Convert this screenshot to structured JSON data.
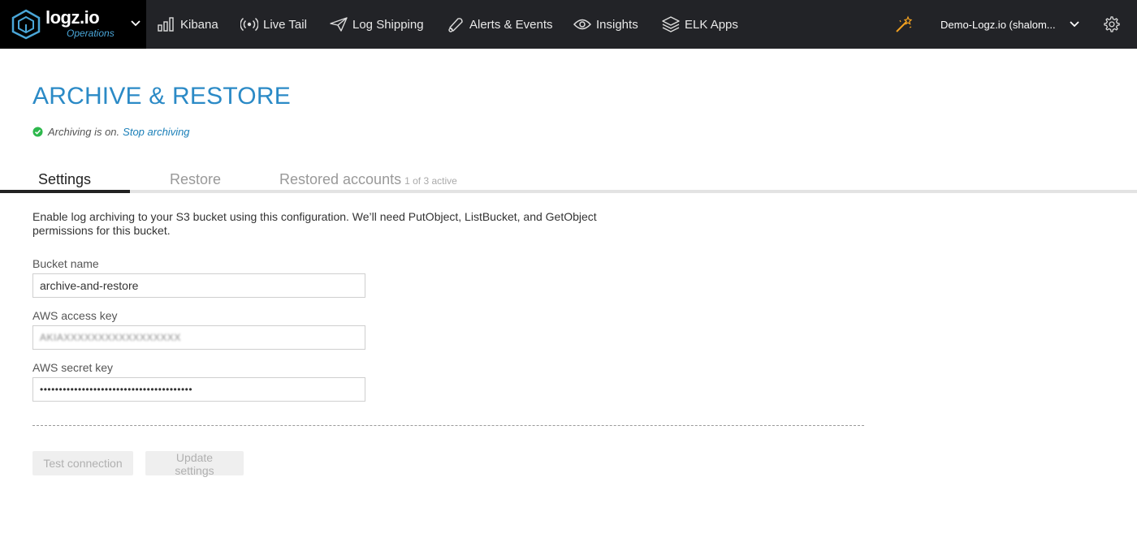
{
  "brand": {
    "name": "logz.io",
    "subtitle": "Operations",
    "accent": "#2b8ac6"
  },
  "nav": {
    "items": [
      {
        "label": "Kibana",
        "icon": "bar-chart-icon"
      },
      {
        "label": "Live Tail",
        "icon": "broadcast-icon"
      },
      {
        "label": "Log Shipping",
        "icon": "paper-plane-icon"
      },
      {
        "label": "Alerts & Events",
        "icon": "bell-icon"
      },
      {
        "label": "Insights",
        "icon": "eye-icon"
      },
      {
        "label": "ELK Apps",
        "icon": "layers-icon"
      }
    ],
    "account": "Demo-Logz.io (shalom..."
  },
  "page": {
    "title": "ARCHIVE & RESTORE",
    "status_text": "Archiving is on.",
    "status_link": "Stop archiving",
    "status_color": "#2db84c"
  },
  "tabs": {
    "settings": "Settings",
    "restore": "Restore",
    "restored_accounts": "Restored accounts",
    "restored_badge": "1 of 3 active"
  },
  "settings": {
    "intro": "Enable log archiving to your S3 bucket using this configuration. We’ll need PutObject, ListBucket, and GetObject permissions for this bucket.",
    "bucket_label": "Bucket name",
    "bucket_value": "archive-and-restore",
    "access_label": "AWS access key",
    "access_value": "AKIAXXXXXXXXXXXXXXXXX",
    "secret_label": "AWS secret key",
    "secret_value": "••••••••••••••••••••••••••••••••••••••••"
  },
  "buttons": {
    "test": "Test connection",
    "update": "Update settings"
  }
}
